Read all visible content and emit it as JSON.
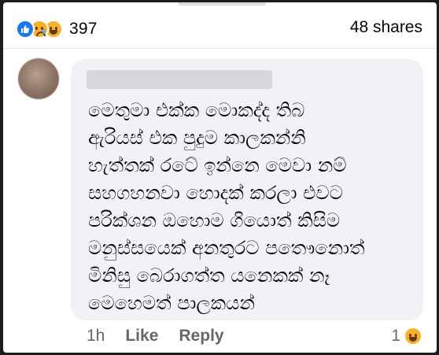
{
  "post_stats": {
    "reaction_icons": [
      "like-icon",
      "sad-icon",
      "haha-icon"
    ],
    "reaction_count": "397",
    "shares": "48 shares"
  },
  "comment": {
    "lines": [
      "මෙතුමා එක්ක මොකද්ද තිබ",
      "ඇරියස් එක පුදුම කාලකන්නි",
      "හැත්තක් රටේ ඉන්නෙ මෙවා නම්",
      "සහගහනවා හොදක් කරලා එවට",
      "පරික්ශන ඔහොම ගියොත් කිසිම",
      "මනුස්සයෙක් අනතුරට පතෞනොත්",
      "මිනිසු බෙරාගත්ත යනෙකක් නෑ",
      "මෙහෙමත් පාලකයන්"
    ],
    "time": "1h",
    "like_label": "Like",
    "reply_label": "Reply",
    "reaction_count": "1",
    "reaction_icon": "haha-icon"
  },
  "colors": {
    "accent": "#1877f2",
    "reaction_yellow": "#f7b125",
    "bubble_bg": "#f0f2f5",
    "meta_text": "#65676b"
  }
}
